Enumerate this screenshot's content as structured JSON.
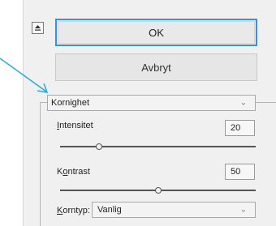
{
  "buttons": {
    "ok": "OK",
    "cancel": "Avbryt"
  },
  "filter_dropdown": {
    "value": "Kornighet"
  },
  "intensity": {
    "label_pre": "",
    "label_u": "I",
    "label_post": "ntensitet",
    "value": "20",
    "slider_fraction": 0.2
  },
  "contrast": {
    "label_pre": "K",
    "label_u": "o",
    "label_post": "ntrast",
    "value": "50",
    "slider_fraction": 0.5
  },
  "grain_type": {
    "label_pre": "",
    "label_u": "K",
    "label_post": "orntyp:",
    "value": "Vanlig"
  },
  "accent": "#3a8ee6"
}
